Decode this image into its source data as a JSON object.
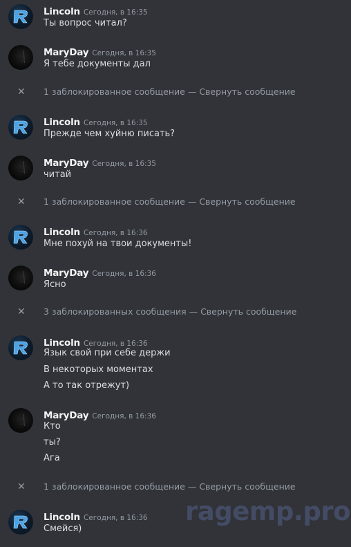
{
  "users": {
    "lincoln": "Lincoln",
    "mary": "MaryDay"
  },
  "blocked": {
    "one": "1 заблокированное сообщение",
    "three": "3 заблокированных сообщения",
    "separator": " — ",
    "collapse": "Свернуть сообщение",
    "x": "✕"
  },
  "groups": [
    {
      "author": "Lincoln",
      "time": "Сегодня, в 16:35",
      "lines": [
        "Ты вопрос читал?"
      ]
    },
    {
      "author": "MaryDay",
      "time": "Сегодня, в 16:35",
      "lines": [
        "Я тебе документы дал"
      ]
    },
    {
      "author": "Lincoln",
      "time": "Сегодня, в 16:35",
      "lines": [
        "Прежде чем хуйню писать?"
      ]
    },
    {
      "author": "MaryDay",
      "time": "Сегодня, в 16:35",
      "lines": [
        "читай"
      ]
    },
    {
      "author": "Lincoln",
      "time": "Сегодня, в 16:36",
      "lines": [
        "Мне похуй на твои документы!"
      ]
    },
    {
      "author": "MaryDay",
      "time": "Сегодня, в 16:36",
      "lines": [
        "Ясно"
      ]
    },
    {
      "author": "Lincoln",
      "time": "Сегодня, в 16:36",
      "lines": [
        "Язык свой при себе держи",
        "В некоторых моментах",
        "А то так отрежут)"
      ]
    },
    {
      "author": "MaryDay",
      "time": "Сегодня, в 16:36",
      "lines": [
        "Кто",
        "ты?",
        "Ага"
      ]
    },
    {
      "author": "Lincoln",
      "time": "Сегодня, в 16:36",
      "lines": [
        "Смейся)"
      ]
    }
  ],
  "watermark": "ragemp.pro",
  "colors": {
    "background": "#313338",
    "text": "#dbdee1",
    "muted": "#949ba4",
    "author": "#f2f3f5",
    "watermark": "#4b5575"
  },
  "icons": {
    "lincoln_avatar": "blue-r-logo",
    "mary_avatar": "dark-photo",
    "blocked": "close-icon"
  }
}
